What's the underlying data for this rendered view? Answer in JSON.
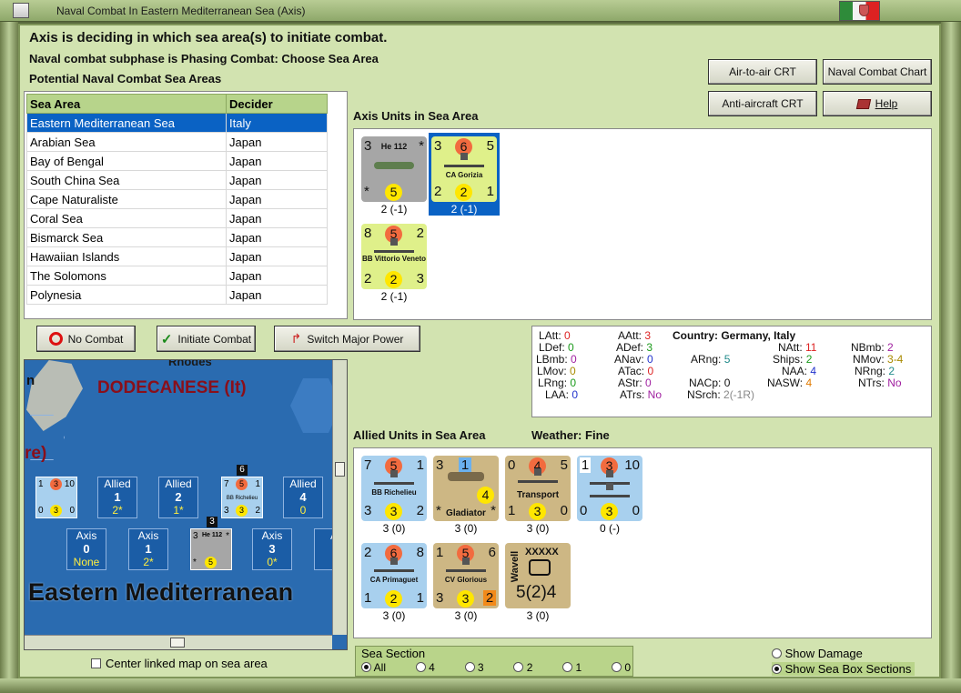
{
  "window": {
    "title": "Naval Combat In Eastern Mediterranean Sea (Axis)"
  },
  "header": {
    "line1": "Axis is deciding in which sea area(s) to initiate combat.",
    "line2": "Naval combat subphase is Phasing Combat: Choose Sea Area",
    "line3": "Potential Naval Combat Sea Areas"
  },
  "buttons": {
    "air_crt": "Air-to-air CRT",
    "naval_chart": "Naval Combat Chart",
    "aa_crt": "Anti-aircraft CRT",
    "help": "Help",
    "no_combat": "No Combat",
    "initiate": "Initiate Combat",
    "switch": "Switch Major Power"
  },
  "sea_table": {
    "headers": [
      "Sea Area",
      "Decider"
    ],
    "rows": [
      [
        "Eastern Mediterranean Sea",
        "Italy"
      ],
      [
        "Arabian Sea",
        "Japan"
      ],
      [
        "Bay of Bengal",
        "Japan"
      ],
      [
        "South China Sea",
        "Japan"
      ],
      [
        "Cape Naturaliste",
        "Japan"
      ],
      [
        "Coral Sea",
        "Japan"
      ],
      [
        "Bismarck Sea",
        "Japan"
      ],
      [
        "Hawaiian Islands",
        "Japan"
      ],
      [
        "The Solomons",
        "Japan"
      ],
      [
        "Polynesia",
        "Japan"
      ]
    ]
  },
  "axis": {
    "label": "Axis Units in Sea Area",
    "units": [
      {
        "name": "He 112",
        "tl": "3",
        "tr": "*",
        "bl": "*",
        "bc": "5",
        "below": "2 (-1)"
      },
      {
        "name": "CA Gorizia",
        "tl": "3",
        "tc": "6",
        "tr": "5",
        "bl": "2",
        "bc": "2",
        "br": "1",
        "below": "2 (-1)"
      },
      {
        "name": "BB Vittorio Veneto",
        "tl": "8",
        "tc": "5",
        "tr": "2",
        "bl": "2",
        "bc": "2",
        "br": "3",
        "below": "2 (-1)"
      }
    ]
  },
  "stats": {
    "LAtt": "0",
    "LDef": "0",
    "LBmb": "0",
    "LMov": "0",
    "LRng": "0",
    "LAA": "0",
    "AAtt": "3",
    "ADef": "3",
    "ANav": "0",
    "ATac": "0",
    "AStr": "0",
    "ATrs": "No",
    "ARng": "5",
    "NACp": "0",
    "NSrch": "2(-1R)",
    "country_label": "Country:",
    "country": "Germany, Italy",
    "NAtt": "11",
    "Ships": "2",
    "NAA": "4",
    "NASW": "4",
    "NBmb": "2",
    "NMov": "3-4",
    "NRng": "2",
    "NTrs": "No"
  },
  "allied": {
    "label": "Allied Units in Sea Area",
    "weather_label": "Weather:",
    "weather": "Fine",
    "units": [
      {
        "name": "BB Richelieu",
        "tl": "7",
        "tc": "5",
        "tr": "1",
        "bl": "3",
        "bc": "3",
        "br": "2",
        "below": "3 (0)"
      },
      {
        "name": "Gladiator",
        "tl": "3",
        "tc": "1",
        "tr": "*",
        "bl": "*",
        "bc": "4",
        "below": "3 (0)"
      },
      {
        "name": "Transport",
        "tl": "0",
        "tc": "4",
        "tr": "5",
        "bl": "1",
        "bc": "3",
        "br": "0",
        "below": "3 (0)"
      },
      {
        "name": "",
        "tl": "1",
        "tc": "3",
        "tr": "10",
        "bl": "0",
        "bc": "3",
        "br": "0",
        "below": "0 (-)"
      },
      {
        "name": "CA Primaguet",
        "tl": "2",
        "tc": "6",
        "tr": "8",
        "bl": "1",
        "bc": "2",
        "br": "1",
        "below": "3 (0)"
      },
      {
        "name": "CV Glorious",
        "tl": "1",
        "tc": "5",
        "tr": "6",
        "bl": "3",
        "bc": "3",
        "br": "2",
        "below": "3 (0)"
      },
      {
        "name": "Wavell",
        "tl": "XXXXX",
        "bc": "5(2)4",
        "below": "3 (0)"
      }
    ]
  },
  "map": {
    "labels": {
      "rhodes": "Rhodes",
      "dodecanese": "DODECANESE (It)",
      "n": "n",
      "re": "re)",
      "east_med": "Eastern Mediterranean"
    },
    "allied_boxes": [
      {
        "t": "Allied",
        "n": "1",
        "s": "2*"
      },
      {
        "t": "Allied",
        "n": "2",
        "s": "1*"
      },
      {
        "t": "Allied",
        "n": "4",
        "s": "0"
      }
    ],
    "axis_boxes": [
      {
        "t": "Axis",
        "n": "0",
        "s": "None"
      },
      {
        "t": "Axis",
        "n": "1",
        "s": "2*"
      },
      {
        "t": "Axis",
        "n": "3",
        "s": "0*"
      },
      {
        "t": "A",
        "n": "",
        "s": ""
      }
    ],
    "map_counter_nums": [
      "6",
      "3"
    ],
    "mini1": {
      "a": "1",
      "b": "3",
      "c": "10",
      "d": "0",
      "e": "3",
      "f": "0"
    },
    "mini2": {
      "name": "BB Richelieu",
      "a": "7",
      "b": "5",
      "c": "1",
      "d": "3",
      "e": "3",
      "f": "2"
    },
    "mini3": {
      "name": "He 112",
      "a": "3",
      "c": "*",
      "d": "*",
      "e": "5"
    }
  },
  "center_checkbox": "Center linked map on sea area",
  "sea_section": {
    "label": "Sea Section",
    "options": [
      "All",
      "4",
      "3",
      "2",
      "1",
      "0"
    ]
  },
  "show": {
    "damage": "Show Damage",
    "sections": "Show Sea Box Sections"
  }
}
